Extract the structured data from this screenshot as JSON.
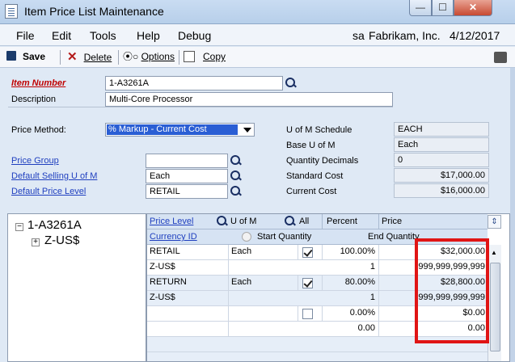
{
  "window": {
    "title": "Item Price List Maintenance",
    "min_label": "—",
    "max_label": "☐",
    "close_label": "✕"
  },
  "menu": {
    "items": [
      "File",
      "Edit",
      "Tools",
      "Help",
      "Debug"
    ],
    "user": "sa",
    "company": "Fabrikam, Inc.",
    "date": "4/12/2017"
  },
  "toolbar": {
    "save": "Save",
    "delete": "Delete",
    "options": "Options",
    "options_prefix": "⦿○",
    "copy": "Copy"
  },
  "form": {
    "item_number_label": "Item Number",
    "item_number": "1-A3261A",
    "description_label": "Description",
    "description": "Multi-Core Processor",
    "price_method_label": "Price Method:",
    "price_method": "% Markup - Current Cost",
    "price_group_label": "Price Group",
    "price_group": "",
    "default_selling_label": "Default Selling U of M",
    "default_selling": "Each",
    "default_price_level_label": "Default Price Level",
    "default_price_level": "RETAIL",
    "uofm_schedule_label": "U of M Schedule",
    "uofm_schedule": "EACH",
    "base_uofm_label": "Base U of M",
    "base_uofm": "Each",
    "qty_decimals_label": "Quantity Decimals",
    "qty_decimals": "0",
    "standard_cost_label": "Standard Cost",
    "standard_cost": "$17,000.00",
    "current_cost_label": "Current Cost",
    "current_cost": "$16,000.00"
  },
  "tree": {
    "root": "1-A3261A",
    "child": "Z-US$",
    "root_toggle": "−",
    "child_toggle": "+"
  },
  "grid": {
    "headers": {
      "price_level": "Price Level",
      "uofm": "U of M",
      "all": "All",
      "percent": "Percent",
      "price": "Price",
      "currency_id": "Currency ID",
      "start_qty": "Start Quantity",
      "end_qty": "End Quantity"
    },
    "rows": [
      {
        "level": "RETAIL",
        "uofm": "Each",
        "checked": true,
        "percent": "100.00%",
        "price": "$32,000.00"
      },
      {
        "level": "Z-US$",
        "uofm": "",
        "start": "1",
        "end": "999,999,999,999"
      },
      {
        "level": "RETURN",
        "uofm": "Each",
        "checked": true,
        "percent": "80.00%",
        "price": "$28,800.00"
      },
      {
        "level": "Z-US$",
        "uofm": "",
        "start": "1",
        "end": "999,999,999,999"
      },
      {
        "level": "",
        "uofm": "",
        "checked": false,
        "percent": "0.00%",
        "price": "$0.00"
      },
      {
        "level": "",
        "uofm": "",
        "start": "0.00",
        "end": "0.00"
      }
    ]
  },
  "colors": {
    "link": "#1f3fbf",
    "required": "#c00000",
    "highlight": "#e01515",
    "selection": "#2a5ed4"
  }
}
